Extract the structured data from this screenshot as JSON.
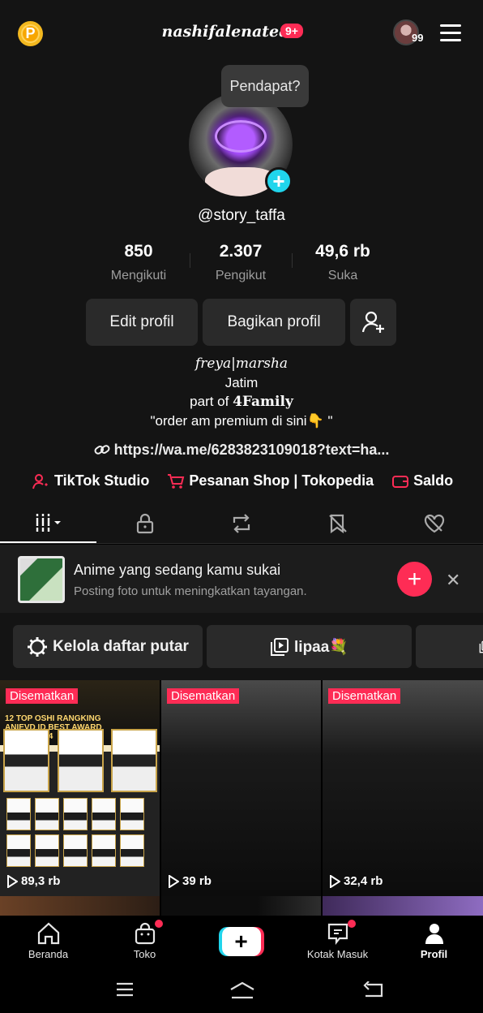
{
  "header": {
    "coin_icon": "P",
    "username": "nashifalenatea",
    "notifications_badge": "9+",
    "story_count": "99"
  },
  "profile": {
    "bubble": "Pendapat?",
    "handle": "@story_taffa",
    "stats": [
      {
        "value": "850",
        "label": "Mengikuti"
      },
      {
        "value": "2.307",
        "label": "Pengikut"
      },
      {
        "value": "49,6 rb",
        "label": "Suka"
      }
    ],
    "edit_button": "Edit profil",
    "share_button": "Bagikan profil",
    "bio_line1": "freya|marsha",
    "bio_line2": "Jatim",
    "bio_line3_prefix": "part of ",
    "bio_line3_bold": "4Family",
    "bio_line4": "\"order am premium di sini👇 \"",
    "link": "https://wa.me/6283823109018?text=ha...",
    "quick_links": [
      "TikTok Studio",
      "Pesanan Shop | Tokopedia",
      "Saldo"
    ]
  },
  "suggestion": {
    "title": "Anime yang sedang kamu sukai",
    "subtitle": "Posting foto untuk meningkatkan tayangan."
  },
  "playlists": {
    "manage": "Kelola daftar putar",
    "item1": "lipaa💐"
  },
  "videos": [
    {
      "pinned": "Disematkan",
      "views": "89,3 rb",
      "rank_text": "12 TOP OSHI RANGKING ANIEVD ID BEST AWARD TAHUN 2024"
    },
    {
      "pinned": "Disematkan",
      "views": "39 rb"
    },
    {
      "pinned": "Disematkan",
      "views": "32,4 rb"
    }
  ],
  "bottom_nav": [
    "Beranda",
    "Toko",
    "",
    "Kotak Masuk",
    "Profil"
  ],
  "colors": {
    "accent": "#fe2c55",
    "cyan": "#20d5ec",
    "background": "#141414"
  }
}
